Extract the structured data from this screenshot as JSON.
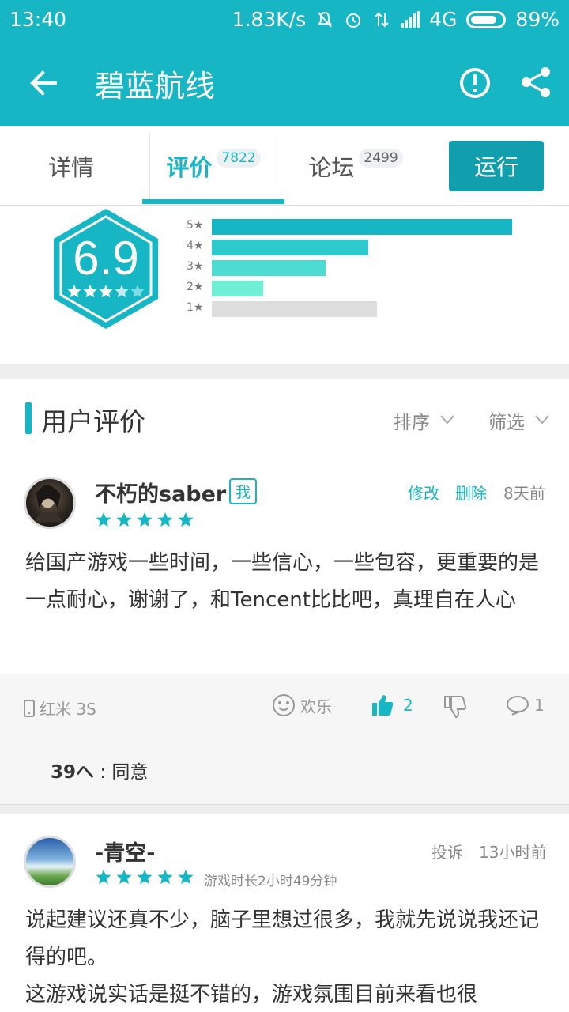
{
  "status_bar": {
    "time": "13:40",
    "speed": "1.83K/s",
    "network": "4G",
    "battery": "89%"
  },
  "app_bar": {
    "title": "碧蓝航线"
  },
  "tabs": [
    {
      "label": "详情",
      "count": ""
    },
    {
      "label": "评价",
      "count": "7822"
    },
    {
      "label": "论坛",
      "count": "2499"
    }
  ],
  "run_button": "运行",
  "rating": {
    "score": "6.9",
    "stars": 3.5,
    "distribution": [
      {
        "label": "5★",
        "fraction": 1.0
      },
      {
        "label": "4★",
        "fraction": 0.52
      },
      {
        "label": "3★",
        "fraction": 0.38
      },
      {
        "label": "2★",
        "fraction": 0.17
      },
      {
        "label": "1★",
        "fraction": 0.55
      }
    ]
  },
  "section": {
    "title": "用户评价",
    "sort": "排序",
    "filter": "筛选"
  },
  "reviews": [
    {
      "username": "不朽的saber",
      "badge": "我",
      "edit": "修改",
      "delete": "删除",
      "time": "8天前",
      "stars": 5,
      "text": "给国产游戏一些时间，一些信心，一些包容，更重要的是一点耐心，谢谢了，和Tencent比比吧，真理自在人心",
      "device": "红米 3S",
      "mood": "欢乐",
      "likes": "2",
      "comments": "1",
      "agree_count": "39",
      "agree_label": ": 同意"
    },
    {
      "username": "-青空-",
      "report": "投诉",
      "time": "13小时前",
      "stars": 5,
      "playtime": "游戏时长2小时49分钟",
      "text": "说起建议还真不少，脑子里想过很多，我就先说说我还记得的吧。\n这游戏说实话是挺不错的，游戏氛围目前来看也很"
    }
  ],
  "colors": {
    "accent": "#17b6c4",
    "accent_dark": "#119fae",
    "bar_5": "#17b6c4",
    "bar_4": "#2cc9cd",
    "bar_3": "#4ddcd1",
    "bar_2": "#6ff0d4",
    "bar_1": "#dddddd"
  }
}
